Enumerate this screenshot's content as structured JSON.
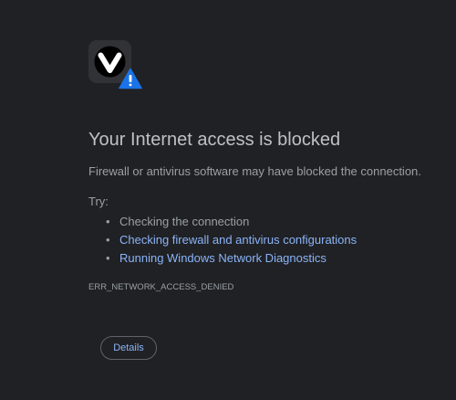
{
  "error": {
    "icon": "vivaldi-logo-icon",
    "badge_icon": "warning-triangle-icon",
    "title": "Your Internet access is blocked",
    "description": "Firewall or antivirus software may have blocked the connection.",
    "try_label": "Try:",
    "suggestions": [
      {
        "text": "Checking the connection",
        "is_link": false
      },
      {
        "text": "Checking firewall and antivirus configurations",
        "is_link": true
      },
      {
        "text": "Running Windows Network Diagnostics",
        "is_link": true
      }
    ],
    "code": "ERR_NETWORK_ACCESS_DENIED",
    "details_button": "Details"
  },
  "colors": {
    "background": "#202124",
    "title": "#bdc1c6",
    "text": "#9aa0a6",
    "link": "#8ab4f8",
    "warning_badge": "#1a73e8"
  }
}
